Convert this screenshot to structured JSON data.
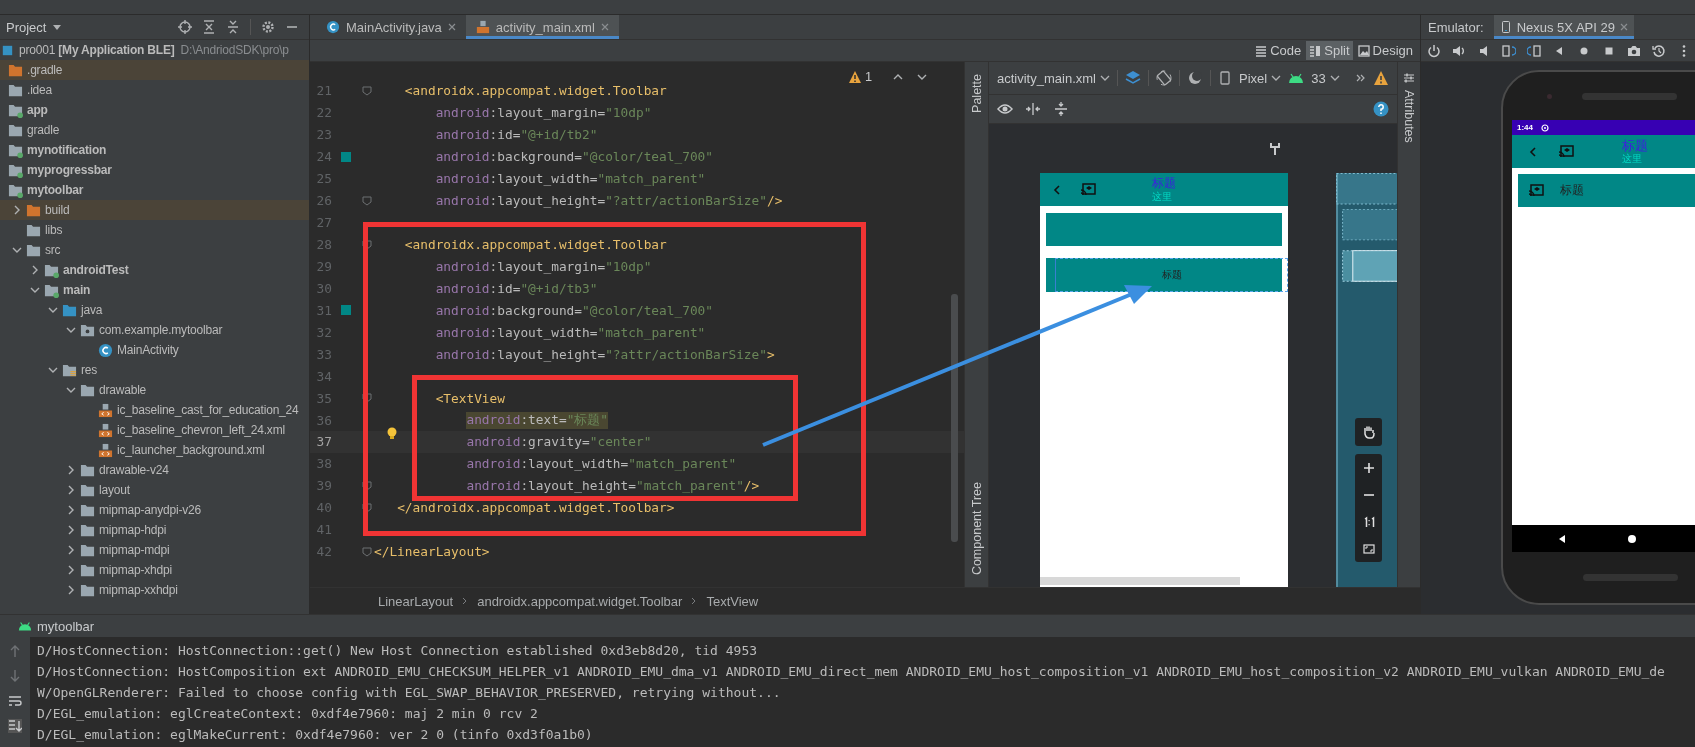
{
  "project_panel": {
    "title": "Project",
    "tree": [
      {
        "label": "pro001 **[My Application BLE]**",
        "path": "D:\\AndriodSDK\\pro\\p",
        "kind": "project",
        "children": [
          {
            "label": ".gradle",
            "kind": "excluded"
          },
          {
            "label": ".idea",
            "kind": "folder"
          },
          {
            "label": "app",
            "kind": "module"
          },
          {
            "label": "gradle",
            "kind": "folder"
          },
          {
            "label": "mynotification",
            "kind": "module"
          },
          {
            "label": "myprogressbar",
            "kind": "module"
          },
          {
            "label": "mytoolbar",
            "kind": "module",
            "children": [
              {
                "label": "build",
                "kind": "excluded",
                "expanded": false
              },
              {
                "label": "libs",
                "kind": "folder"
              },
              {
                "label": "src",
                "kind": "folder",
                "expanded": true,
                "children": [
                  {
                    "label": "androidTest",
                    "kind": "module",
                    "expanded": false
                  },
                  {
                    "label": "main",
                    "kind": "module",
                    "expanded": true,
                    "children": [
                      {
                        "label": "java",
                        "kind": "source",
                        "expanded": true,
                        "children": [
                          {
                            "label": "com.example.mytoolbar",
                            "kind": "package",
                            "expanded": true,
                            "children": [
                              {
                                "label": "MainActivity",
                                "kind": "class"
                              }
                            ]
                          }
                        ]
                      },
                      {
                        "label": "res",
                        "kind": "resources",
                        "expanded": true,
                        "children": [
                          {
                            "label": "drawable",
                            "kind": "folder",
                            "expanded": true,
                            "children": [
                              {
                                "label": "ic_baseline_cast_for_education_24",
                                "kind": "xml"
                              },
                              {
                                "label": "ic_baseline_chevron_left_24.xml",
                                "kind": "xml"
                              },
                              {
                                "label": "ic_launcher_background.xml",
                                "kind": "xml"
                              }
                            ]
                          },
                          {
                            "label": "drawable-v24",
                            "kind": "folder",
                            "expanded": false
                          },
                          {
                            "label": "layout",
                            "kind": "folder",
                            "expanded": false
                          },
                          {
                            "label": "mipmap-anydpi-v26",
                            "kind": "folder",
                            "expanded": false
                          },
                          {
                            "label": "mipmap-hdpi",
                            "kind": "folder",
                            "expanded": false
                          },
                          {
                            "label": "mipmap-mdpi",
                            "kind": "folder",
                            "expanded": false
                          },
                          {
                            "label": "mipmap-xhdpi",
                            "kind": "folder",
                            "expanded": false
                          },
                          {
                            "label": "mipmap-xxhdpi",
                            "kind": "folder",
                            "expanded": false
                          }
                        ]
                      }
                    ]
                  }
                ]
              }
            ]
          }
        ]
      }
    ]
  },
  "editor": {
    "tabs": [
      {
        "label": "MainActivity.java",
        "kind": "class",
        "selected": false
      },
      {
        "label": "activity_main.xml",
        "kind": "xml",
        "selected": true
      }
    ],
    "view_modes": [
      {
        "label": "Code",
        "kind": "code",
        "selected": false
      },
      {
        "label": "Split",
        "kind": "split",
        "selected": true
      },
      {
        "label": "Design",
        "kind": "design",
        "selected": false
      }
    ],
    "warning_count": "1",
    "lines": [
      {
        "number": "21",
        "fold_marker": true,
        "segments": [
          {
            "kind": "tag",
            "text": "    <androidx.appcompat.widget.Toolbar"
          }
        ]
      },
      {
        "number": "22",
        "fold_marker": false,
        "segments": [
          {
            "kind": "ns",
            "text": "        android"
          },
          {
            "kind": "attr",
            "text": ":layout_margin="
          },
          {
            "kind": "str",
            "text": "\"10dp\""
          }
        ]
      },
      {
        "number": "23",
        "fold_marker": false,
        "segments": [
          {
            "kind": "ns",
            "text": "        android"
          },
          {
            "kind": "attr",
            "text": ":id="
          },
          {
            "kind": "str",
            "text": "\"@+id/tb2\""
          }
        ]
      },
      {
        "number": "24",
        "fold_marker": false,
        "color": "#018786",
        "segments": [
          {
            "kind": "ns",
            "text": "        android"
          },
          {
            "kind": "attr",
            "text": ":background="
          },
          {
            "kind": "str",
            "text": "\"@color/teal_700\""
          }
        ]
      },
      {
        "number": "25",
        "fold_marker": false,
        "segments": [
          {
            "kind": "ns",
            "text": "        android"
          },
          {
            "kind": "attr",
            "text": ":layout_width="
          },
          {
            "kind": "str",
            "text": "\"match_parent\""
          }
        ]
      },
      {
        "number": "26",
        "fold_marker": true,
        "segments": [
          {
            "kind": "ns",
            "text": "        android"
          },
          {
            "kind": "attr",
            "text": ":layout_height="
          },
          {
            "kind": "str",
            "text": "\"?attr/actionBarSize\""
          },
          {
            "kind": "tag",
            "text": "/>"
          }
        ]
      },
      {
        "number": "27",
        "fold_marker": false
      },
      {
        "number": "28",
        "fold_marker": true,
        "segments": [
          {
            "kind": "tag",
            "text": "    <androidx.appcompat.widget.Toolbar"
          }
        ]
      },
      {
        "number": "29",
        "fold_marker": false,
        "segments": [
          {
            "kind": "ns",
            "text": "        android"
          },
          {
            "kind": "attr",
            "text": ":layout_margin="
          },
          {
            "kind": "str",
            "text": "\"10dp\""
          }
        ]
      },
      {
        "number": "30",
        "fold_marker": false,
        "segments": [
          {
            "kind": "ns",
            "text": "        android"
          },
          {
            "kind": "attr",
            "text": ":id="
          },
          {
            "kind": "str",
            "text": "\"@+id/tb3\""
          }
        ]
      },
      {
        "number": "31",
        "fold_marker": false,
        "color": "#018786",
        "segments": [
          {
            "kind": "ns",
            "text": "        android"
          },
          {
            "kind": "attr",
            "text": ":background="
          },
          {
            "kind": "str",
            "text": "\"@color/teal_700\""
          }
        ]
      },
      {
        "number": "32",
        "fold_marker": false,
        "segments": [
          {
            "kind": "ns",
            "text": "        android"
          },
          {
            "kind": "attr",
            "text": ":layout_width="
          },
          {
            "kind": "str",
            "text": "\"match_parent\""
          }
        ]
      },
      {
        "number": "33",
        "fold_marker": false,
        "segments": [
          {
            "kind": "ns",
            "text": "        android"
          },
          {
            "kind": "attr",
            "text": ":layout_height="
          },
          {
            "kind": "str",
            "text": "\"?attr/actionBarSize\""
          },
          {
            "kind": "tag",
            "text": ">"
          }
        ]
      },
      {
        "number": "34",
        "fold_marker": false
      },
      {
        "number": "35",
        "fold_marker": true,
        "segments": [
          {
            "kind": "tag",
            "text": "        <TextView"
          }
        ]
      },
      {
        "number": "36",
        "fold_marker": false,
        "highlighted": true,
        "segments": [
          {
            "kind": "ns",
            "text": "            android"
          },
          {
            "kind": "attr",
            "text": ":text="
          },
          {
            "kind": "str",
            "text": "\"标题\""
          }
        ]
      },
      {
        "number": "37",
        "fold_marker": false,
        "bulb": true,
        "current": true,
        "segments": [
          {
            "kind": "ns",
            "text": "            android"
          },
          {
            "kind": "attr",
            "text": ":gravity="
          },
          {
            "kind": "str",
            "text": "\"center\""
          }
        ]
      },
      {
        "number": "38",
        "fold_marker": false,
        "segments": [
          {
            "kind": "ns",
            "text": "            android"
          },
          {
            "kind": "attr",
            "text": ":layout_width="
          },
          {
            "kind": "str",
            "text": "\"match_parent\""
          }
        ]
      },
      {
        "number": "39",
        "fold_marker": true,
        "segments": [
          {
            "kind": "ns",
            "text": "            android"
          },
          {
            "kind": "attr",
            "text": ":layout_height="
          },
          {
            "kind": "str",
            "text": "\"match_parent\""
          },
          {
            "kind": "tag",
            "text": "/>"
          }
        ]
      },
      {
        "number": "40",
        "fold_marker": true,
        "segments": [
          {
            "kind": "tag",
            "text": "   </androidx.appcompat.widget.Toolbar>"
          }
        ]
      },
      {
        "number": "41",
        "fold_marker": false
      },
      {
        "number": "42",
        "fold_marker": true,
        "segments": [
          {
            "kind": "tag",
            "text": "</LinearLayout>"
          }
        ]
      }
    ],
    "breadcrumb": [
      "LinearLayout",
      "androidx.appcompat.widget.Toolbar",
      "TextView"
    ]
  },
  "design": {
    "file": "activity_main.xml",
    "device": "Pixel",
    "api": "33",
    "palette_tab": "Palette",
    "tree_tab": "Component Tree",
    "attributes_tab": "Attributes",
    "preview": {
      "title": "标题",
      "subtitle": "这里",
      "toolbar_text": "标题"
    }
  },
  "emulator": {
    "label": "Emulator:",
    "device_tab": "Nexus 5X API 29",
    "screen": {
      "time": "1:44",
      "title": "标题",
      "subtitle": "这里",
      "toolbar_text": "标题"
    }
  },
  "run_panel": {
    "title": "mytoolbar",
    "lines": [
      "D/HostConnection: HostConnection::get() New Host Connection established 0xd3eb8d20, tid 4953",
      "D/HostConnection: HostComposition ext ANDROID_EMU_CHECKSUM_HELPER_v1 ANDROID_EMU_dma_v1 ANDROID_EMU_direct_mem ANDROID_EMU_host_composition_v1 ANDROID_EMU_host_composition_v2 ANDROID_EMU_vulkan ANDROID_EMU_de",
      "W/OpenGLRenderer: Failed to choose config with EGL_SWAP_BEHAVIOR_PRESERVED, retrying without...",
      "D/EGL_emulation: eglCreateContext: 0xdf4e7960: maj 2 min 0 rcv 2",
      "D/EGL_emulation: eglMakeCurrent: 0xdf4e7960: ver 2 0 (tinfo 0xd3f0a1b0)"
    ]
  }
}
